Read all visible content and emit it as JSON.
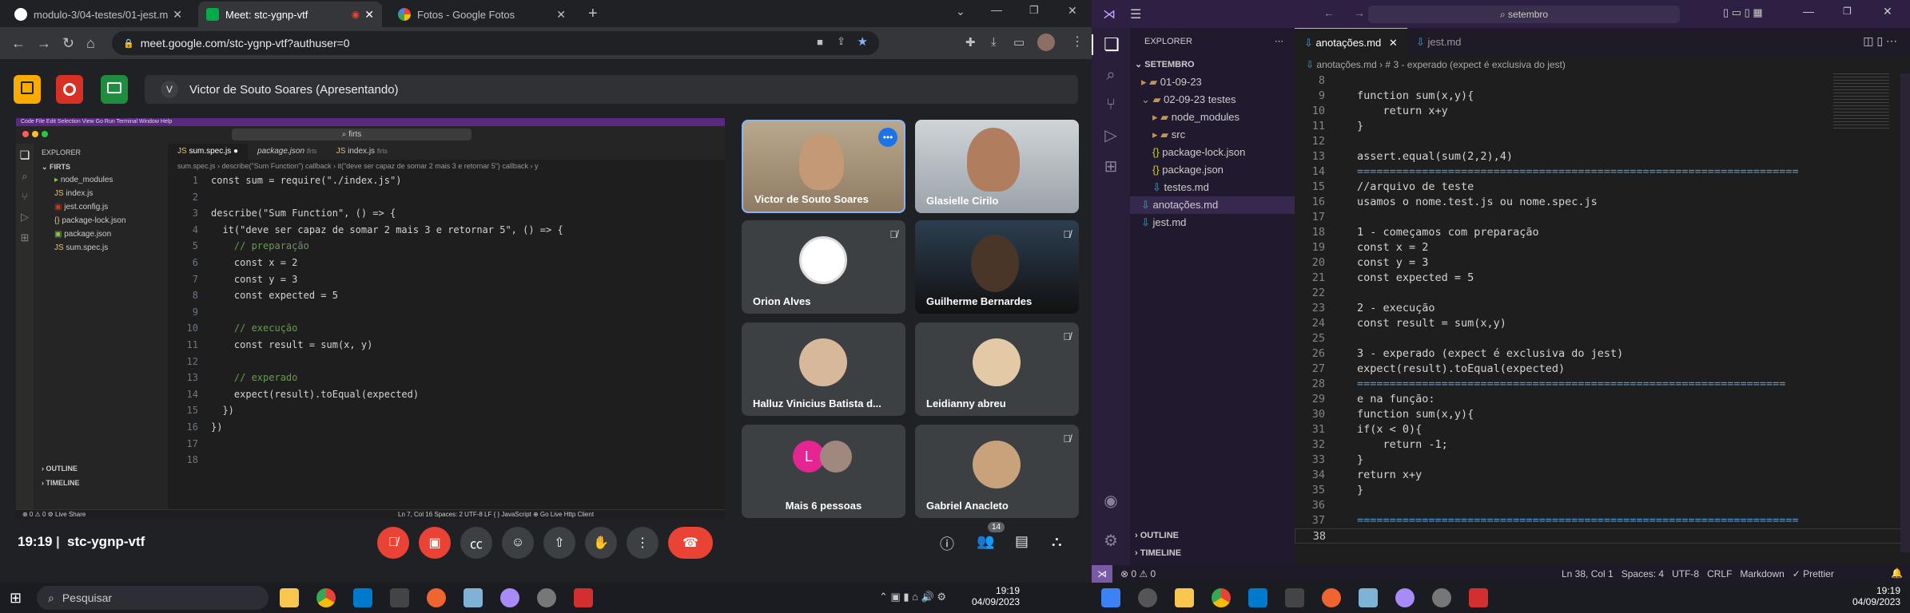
{
  "browser": {
    "tabs": [
      {
        "label": "modulo-3/04-testes/01-jest.md",
        "icon_color": "#ffffff"
      },
      {
        "label": "Meet: stc-ygnp-vtf",
        "icon_color": "#00ac47"
      },
      {
        "label": "Fotos - Google Fotos",
        "icon_color": "#fbbc04"
      }
    ],
    "url": "meet.google.com/stc-ygnp-vtf?authuser=0"
  },
  "meet": {
    "presenter_initial": "V",
    "presenter_label": "Victor de Souto Soares (Apresentando)",
    "time": "19:19",
    "code": "stc-ygnp-vtf",
    "participants_count": "14",
    "tiles": [
      {
        "name": "Victor de Souto Soares"
      },
      {
        "name": "Glasielle Cirilo"
      },
      {
        "name": "Orion Alves"
      },
      {
        "name": "Guilherme Bernardes"
      },
      {
        "name": "Halluz Vinicius Batista d..."
      },
      {
        "name": "Leidianny abreu"
      },
      {
        "name": "Mais 6 pessoas",
        "initial": "L"
      },
      {
        "name": "Gabriel Anacleto"
      }
    ]
  },
  "shared_vscode": {
    "search": "firts",
    "explorer_title": "EXPLORER",
    "root": "FIRTS",
    "files": [
      "node_modules",
      "index.js",
      "jest.config.js",
      "package-lock.json",
      "package.json",
      "sum.spec.js"
    ],
    "outline": "OUTLINE",
    "timeline": "TIMELINE",
    "tabs": [
      "sum.spec.js",
      "package.json",
      "index.js"
    ],
    "tab_hints": [
      "firts",
      "firts",
      "firts"
    ],
    "breadcrumb": "sum.spec.js › describe(\"Sum Function\") callback › it(\"deve ser capaz de somar 2 mais 3 e retornar 5\") callback › y",
    "code": [
      {
        "n": "1",
        "t": "const sum = require(\"./index.js\")"
      },
      {
        "n": "2",
        "t": ""
      },
      {
        "n": "3",
        "t": "describe(\"Sum Function\", () => {"
      },
      {
        "n": "4",
        "t": "  it(\"deve ser capaz de somar 2 mais 3 e retornar 5\", () => {"
      },
      {
        "n": "5",
        "t": "    // preparação"
      },
      {
        "n": "6",
        "t": "    const x = 2"
      },
      {
        "n": "7",
        "t": "    const y = 3"
      },
      {
        "n": "8",
        "t": "    const expected = 5"
      },
      {
        "n": "9",
        "t": ""
      },
      {
        "n": "10",
        "t": "    // execução"
      },
      {
        "n": "11",
        "t": "    const result = sum(x, y)"
      },
      {
        "n": "12",
        "t": ""
      },
      {
        "n": "13",
        "t": "    // experado"
      },
      {
        "n": "14",
        "t": "    expect(result).toEqual(expected)"
      },
      {
        "n": "15",
        "t": "  })"
      },
      {
        "n": "16",
        "t": "})"
      },
      {
        "n": "17",
        "t": ""
      },
      {
        "n": "18",
        "t": ""
      }
    ],
    "status": "Ln 7, Col 16   Spaces: 2   UTF-8   LF   { } JavaScript   ⊕ Go Live   Http Client",
    "status_left": "⊗ 0 ⚠ 0   ⚙ Live Share"
  },
  "vscode": {
    "search": "setembro",
    "explorer_title": "EXPLORER",
    "root": "SETEMBRO",
    "tree": [
      {
        "label": "01-09-23",
        "kind": "folder",
        "indent": 1
      },
      {
        "label": "02-09-23 testes",
        "kind": "folder-open",
        "indent": 1
      },
      {
        "label": "node_modules",
        "kind": "folder",
        "indent": 2
      },
      {
        "label": "src",
        "kind": "folder",
        "indent": 2
      },
      {
        "label": "package-lock.json",
        "kind": "json",
        "indent": 2
      },
      {
        "label": "package.json",
        "kind": "json",
        "indent": 2
      },
      {
        "label": "testes.md",
        "kind": "md",
        "indent": 2
      },
      {
        "label": "anotações.md",
        "kind": "md",
        "indent": 1
      },
      {
        "label": "jest.md",
        "kind": "md",
        "indent": 1
      }
    ],
    "outline": "OUTLINE",
    "timeline": "TIMELINE",
    "tabs": [
      "anotações.md",
      "jest.md"
    ],
    "breadcrumb": "anotações.md › # 3 - experado (expect é exclusiva do jest)",
    "code": [
      {
        "n": "8",
        "t": ""
      },
      {
        "n": "9",
        "t": "function sum(x,y){"
      },
      {
        "n": "10",
        "t": "    return x+y"
      },
      {
        "n": "11",
        "t": "}"
      },
      {
        "n": "12",
        "t": ""
      },
      {
        "n": "13",
        "t": "assert.equal(sum(2,2),4)"
      },
      {
        "n": "14",
        "t": "===================================================================="
      },
      {
        "n": "15",
        "t": "//arquivo de teste"
      },
      {
        "n": "16",
        "t": "usamos o nome.test.js ou nome.spec.js"
      },
      {
        "n": "17",
        "t": ""
      },
      {
        "n": "18",
        "t": "1 - começamos com preparação"
      },
      {
        "n": "19",
        "t": "const x = 2"
      },
      {
        "n": "20",
        "t": "const y = 3"
      },
      {
        "n": "21",
        "t": "const expected = 5"
      },
      {
        "n": "22",
        "t": ""
      },
      {
        "n": "23",
        "t": "2 - execução"
      },
      {
        "n": "24",
        "t": "const result = sum(x,y)"
      },
      {
        "n": "25",
        "t": ""
      },
      {
        "n": "26",
        "t": "3 - experado (expect é exclusiva do jest)"
      },
      {
        "n": "27",
        "t": "expect(result).toEqual(expected)"
      },
      {
        "n": "28",
        "t": "=================================================================="
      },
      {
        "n": "29",
        "t": "e na função:"
      },
      {
        "n": "30",
        "t": "function sum(x,y){"
      },
      {
        "n": "31",
        "t": "if(x < 0){"
      },
      {
        "n": "32",
        "t": "    return -1;"
      },
      {
        "n": "33",
        "t": "}"
      },
      {
        "n": "34",
        "t": "return x+y"
      },
      {
        "n": "35",
        "t": "}"
      },
      {
        "n": "36",
        "t": ""
      },
      {
        "n": "37",
        "t": "===================================================================="
      },
      {
        "n": "38",
        "t": ""
      }
    ],
    "status_left": "⊗ 0 ⚠ 0",
    "status_right": "Ln 38, Col 1   Spaces: 4   UTF-8   CRLF   Markdown   ✓ Prettier"
  },
  "taskbar": {
    "search": "Pesquisar",
    "time": "19:19",
    "date": "04/09/2023"
  }
}
